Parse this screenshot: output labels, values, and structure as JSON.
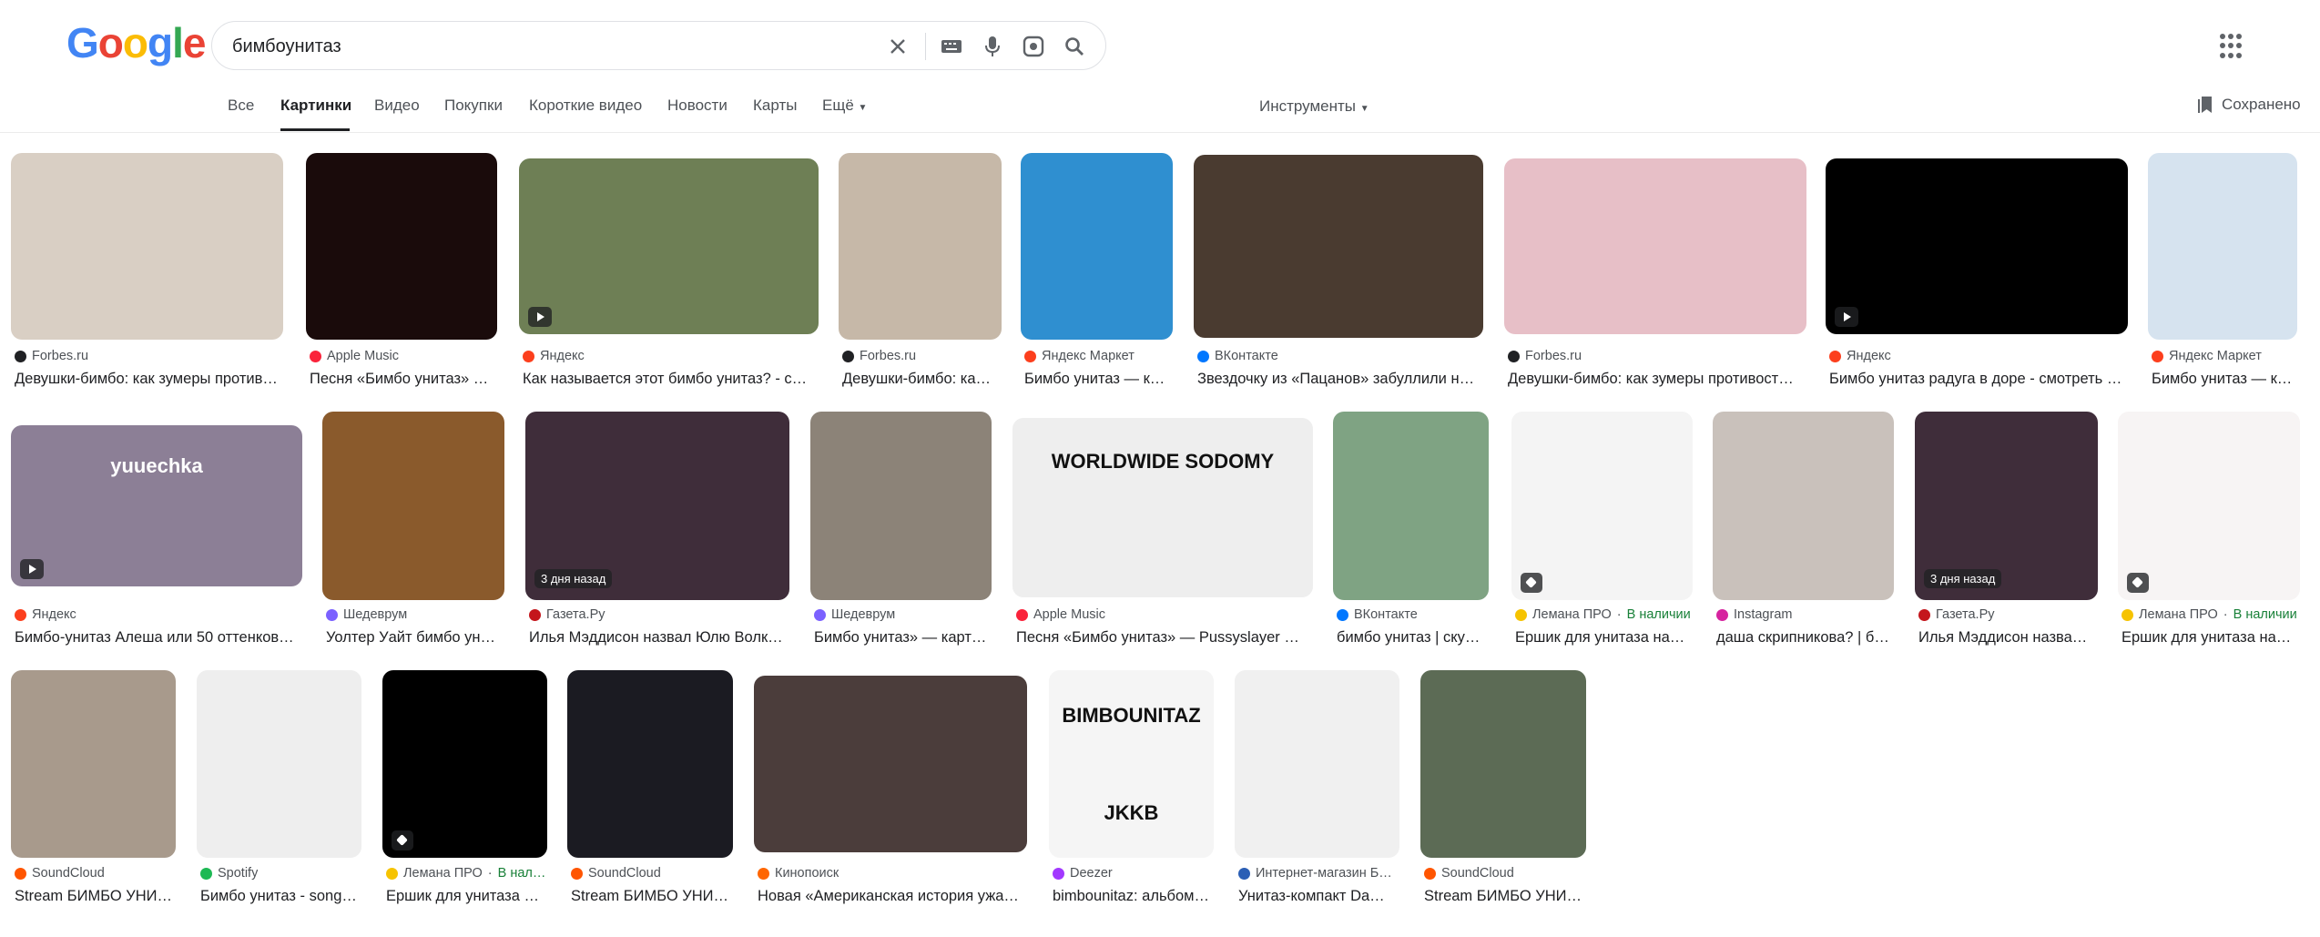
{
  "logo": {
    "text": "Google",
    "letters": [
      "G",
      "o",
      "o",
      "g",
      "l",
      "e"
    ],
    "colors": [
      "#4285f4",
      "#ea4335",
      "#fbbc05",
      "#4285f4",
      "#34a853",
      "#ea4335"
    ]
  },
  "search": {
    "query": "бимбоунитаз"
  },
  "tabs": [
    "Все",
    "Картинки",
    "Видео",
    "Покупки",
    "Короткие видео",
    "Новости",
    "Карты",
    "Ещё"
  ],
  "tools": "Инструменты",
  "saved": "Сохранено",
  "accent": "#1a73e8",
  "results": [
    {
      "source": "Forbes.ru",
      "title": "Девушки-бимбо: как зумеры против…",
      "favicon": "#202124",
      "thumb": "#d9cfc4"
    },
    {
      "source": "Apple Music",
      "title": "Песня «Бимбо унитаз» …",
      "favicon": "#fa233b",
      "thumb": "#1a0b0b"
    },
    {
      "source": "Яндекс",
      "title": "Как называется этот бимбо унитаз? - с…",
      "favicon": "#fc3f1d",
      "thumb": "#6e7f55"
    },
    {
      "source": "Forbes.ru",
      "title": "Девушки-бимбо: ка…",
      "favicon": "#202124",
      "thumb": "#c6b8a8"
    },
    {
      "source": "Яндекс Маркет",
      "title": "Бимбо унитаз — к…",
      "favicon": "#fc3f1d",
      "thumb": "#2f8fd0"
    },
    {
      "source": "ВКонтакте",
      "title": "Звездочку из «Пацанов» забуллили н…",
      "favicon": "#0077ff",
      "thumb": "#4a3b30"
    },
    {
      "source": "Forbes.ru",
      "title": "Девушки-бимбо: как зумеры противост…",
      "favicon": "#202124",
      "thumb": "#e7bfc7"
    },
    {
      "source": "Яндекс",
      "title": "Бимбо унитаз радуга в доре - смотреть …",
      "favicon": "#fc3f1d",
      "thumb": "#000000"
    },
    {
      "source": "Яндекс Маркет",
      "title": "Бимбо унитаз — к…",
      "favicon": "#fc3f1d",
      "thumb": "#d6e3ef"
    },
    {
      "source": "Яндекс",
      "title": "Бимбо-унитаз Алеша или 50 оттенков…",
      "favicon": "#fc3f1d",
      "thumb": "#8c7f96",
      "overlay": "yuuechka"
    },
    {
      "source": "Шедеврум",
      "title": "Уолтер Уайт бимбо ун…",
      "favicon": "#7b61ff",
      "thumb": "#8a5a2c"
    },
    {
      "source": "Газета.Ру",
      "title": "Илья Мэддисон назвал Юлю Волк…",
      "favicon": "#c4161c",
      "thumb": "#3f2d3a",
      "badge": "3 дня назад"
    },
    {
      "source": "Шедеврум",
      "title": "Бимбо унитаз» — карт…",
      "favicon": "#7b61ff",
      "thumb": "#8c8378"
    },
    {
      "source": "Apple Music",
      "title": "Песня «Бимбо унитаз» — Pussyslayer …",
      "favicon": "#fa233b",
      "thumb": "#eeeeee",
      "overlay": "WORLDWIDE SODOMY"
    },
    {
      "source": "ВКонтакте",
      "title": "бимбо унитаз | ску…",
      "favicon": "#0077ff",
      "thumb": "#7fa383"
    },
    {
      "source": "Лемана ПРО",
      "avail": "В наличии",
      "title": "Ершик для унитаза на…",
      "favicon": "#f6c300",
      "thumb": "#f4f4f4"
    },
    {
      "source": "Instagram",
      "title": "даша скрипникова? | б…",
      "favicon": "#d6249f",
      "thumb": "#c9c1bb"
    },
    {
      "source": "Газета.Ру",
      "title": "Илья Мэддисон назва…",
      "favicon": "#c4161c",
      "thumb": "#3f2d3a",
      "badge": "3 дня назад"
    },
    {
      "source": "Лемана ПРО",
      "avail": "В наличии",
      "title": "Ершик для унитаза на…",
      "favicon": "#f6c300",
      "thumb": "#f7f4f4"
    },
    {
      "source": "SoundCloud",
      "title": "Stream БИМБО УНИ…",
      "favicon": "#ff5500",
      "thumb": "#a89a8c"
    },
    {
      "source": "Spotify",
      "title": "Бимбо унитаз - song…",
      "favicon": "#1db954",
      "thumb": "#eeeeee"
    },
    {
      "source": "Лемана ПРО",
      "avail": "В нал…",
      "title": "Ершик для унитаза …",
      "favicon": "#f6c300",
      "thumb": "#000000"
    },
    {
      "source": "SoundCloud",
      "title": "Stream БИМБО УНИ…",
      "favicon": "#ff5500",
      "thumb": "#1b1b22"
    },
    {
      "source": "Кинопоиск",
      "title": "Новая «Американская история ужа…",
      "favicon": "#ff6600",
      "thumb": "#4b3d3b"
    },
    {
      "source": "Deezer",
      "title": "bimbounitaz: альбом…",
      "favicon": "#a238ff",
      "thumb": "#f5f5f5",
      "overlay": "BIMBOUNITAZ",
      "overlay2": "JKKB"
    },
    {
      "source": "Интернет-магазин Б…",
      "title": "Унитаз-компакт Da…",
      "favicon": "#2b5fb5",
      "thumb": "#f0f0f0"
    },
    {
      "source": "SoundCloud",
      "title": "Stream БИМБО УНИ…",
      "favicon": "#ff5500",
      "thumb": "#5c6b55"
    }
  ]
}
